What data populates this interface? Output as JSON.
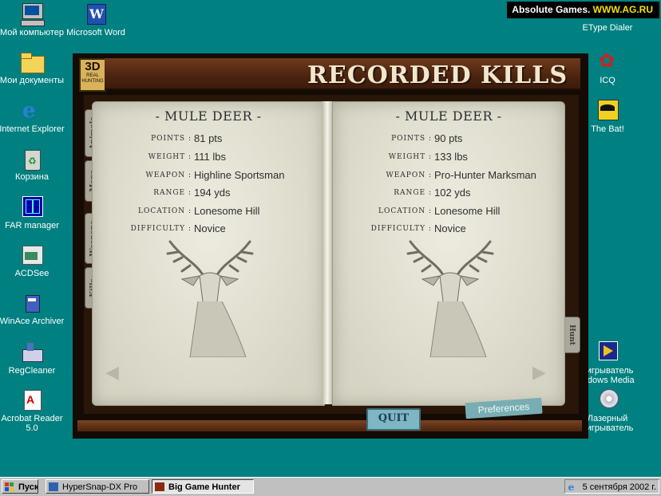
{
  "desktop": {
    "icons_left": [
      {
        "label": "Мой компьютер",
        "icon": "my-computer-icon"
      },
      {
        "label": "Мои документы",
        "icon": "my-documents-icon"
      },
      {
        "label": "Internet Explorer",
        "icon": "internet-explorer-icon"
      },
      {
        "label": "Корзина",
        "icon": "recycle-bin-icon"
      },
      {
        "label": "FAR manager",
        "icon": "far-manager-icon"
      },
      {
        "label": "ACDSee",
        "icon": "acdsee-icon"
      },
      {
        "label": "WinAce Archiver",
        "icon": "winace-icon"
      },
      {
        "label": "RegCleaner",
        "icon": "regcleaner-icon"
      },
      {
        "label": "Acrobat Reader 5.0",
        "icon": "acrobat-icon"
      }
    ],
    "icons_second_column": [
      {
        "label": "Microsoft Word",
        "icon": "word-icon"
      }
    ],
    "icons_right": [
      {
        "label": "EType Dialer",
        "icon": "etype-dialer-icon"
      },
      {
        "label": "ICQ",
        "icon": "icq-icon"
      },
      {
        "label": "The Bat!",
        "icon": "the-bat-icon"
      },
      {
        "label": "Проигрыватель Windows Media",
        "line1": "оигрыватель",
        "line2": "indows Media",
        "icon": "windows-media-icon"
      },
      {
        "label": "Лазерный проигрыватель",
        "line1": "Лазерный",
        "line2": "оигрыватель",
        "icon": "cd-player-icon"
      }
    ]
  },
  "watermark": {
    "prefix": "Absolute Games.",
    "accent": "WWW.AG.RU"
  },
  "game": {
    "title": "RECORDED KILLS",
    "logo_top": "3D",
    "logo_bottom": "REAL HUNTING",
    "tabs_left": [
      "Animals",
      "Maps",
      "Weapons",
      "Kills"
    ],
    "tab_right": "Hunt",
    "quit_label": "QUIT",
    "preferences_label": "Preferences",
    "field_labels": {
      "points": "POINTS :",
      "weight": "WEIGHT :",
      "weapon": "WEAPON :",
      "range": "RANGE :",
      "location": "LOCATION :",
      "difficulty": "DIFFICULTY :"
    },
    "left_page": {
      "heading": "- MULE DEER -",
      "points": "81 pts",
      "weight": "111 lbs",
      "weapon": "Highline Sportsman",
      "range": "194 yds",
      "location": "Lonesome Hill",
      "difficulty": "Novice"
    },
    "right_page": {
      "heading": "- MULE DEER -",
      "points": "90 pts",
      "weight": "133 lbs",
      "weapon": "Pro-Hunter Marksman",
      "range": "102 yds",
      "location": "Lonesome Hill",
      "difficulty": "Novice"
    },
    "prev_arrow": "◀",
    "next_arrow": "▶"
  },
  "taskbar": {
    "start_label": "Пуск",
    "buttons": [
      {
        "label": "HyperSnap-DX Pro",
        "active": false
      },
      {
        "label": "Big Game Hunter",
        "active": true
      }
    ],
    "clock": "5 сентября 2002 г."
  },
  "colors": {
    "desktop": "#008080",
    "wood": "#4b240f",
    "page": "#e6e5d7",
    "quit": "#7fb6c4"
  }
}
